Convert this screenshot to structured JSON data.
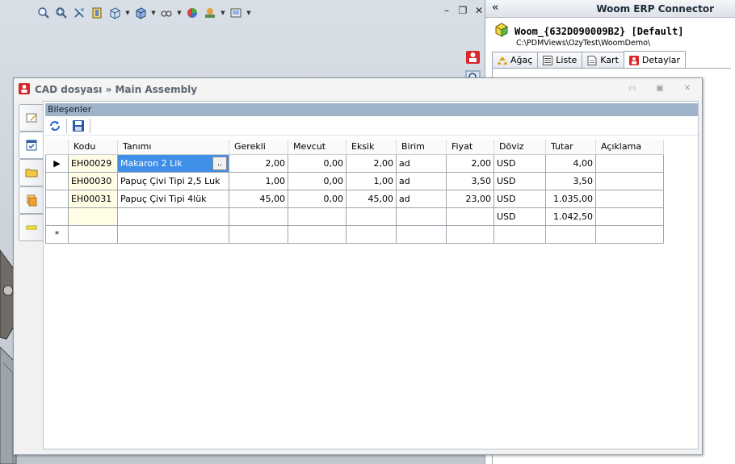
{
  "erp": {
    "title": "Woom ERP Connector",
    "collapse": "«",
    "doc_name": "Woom_{632D090009B2} [Default]",
    "doc_path": "C:\\PDMViews\\OzyTest\\WoomDemo\\",
    "tabs": [
      {
        "label": "Ağaç",
        "icon": "tree-icon",
        "active": false
      },
      {
        "label": "Liste",
        "icon": "list-icon",
        "active": false
      },
      {
        "label": "Kart",
        "icon": "card-icon",
        "active": false
      },
      {
        "label": "Detaylar",
        "icon": "om-logo-icon",
        "active": true
      }
    ]
  },
  "cad_window": {
    "title": "CAD dosyası » Main Assembly",
    "group_title": "Bileşenler",
    "columns": [
      "Kodu",
      "Tanımı",
      "Gerekli",
      "Mevcut",
      "Eksik",
      "Birim",
      "Fiyat",
      "Döviz",
      "Tutar",
      "Açıklama"
    ],
    "rows": [
      {
        "indicator": "▶",
        "kodu": "EH00029",
        "tanimi": "Makaron 2 Lik",
        "gerekli": "2,00",
        "mevcut": "0,00",
        "eksik": "2,00",
        "birim": "ad",
        "fiyat": "2,00",
        "doviz": "USD",
        "tutar": "4,00",
        "aciklama": ""
      },
      {
        "indicator": "",
        "kodu": "EH00030",
        "tanimi": "Papuç Çivi Tipi 2,5 Luk",
        "gerekli": "1,00",
        "mevcut": "0,00",
        "eksik": "1,00",
        "birim": "ad",
        "fiyat": "3,50",
        "doviz": "USD",
        "tutar": "3,50",
        "aciklama": ""
      },
      {
        "indicator": "",
        "kodu": "EH00031",
        "tanimi": "Papuç Çivi Tipi 4lük",
        "gerekli": "45,00",
        "mevcut": "0,00",
        "eksik": "45,00",
        "birim": "ad",
        "fiyat": "23,00",
        "doviz": "USD",
        "tutar": "1.035,00",
        "aciklama": ""
      }
    ],
    "total": {
      "doviz": "USD",
      "tutar": "1.042,50"
    },
    "new_row_indicator": "*",
    "editor_button": ".."
  },
  "colors": {
    "selection": "#3f8fe8",
    "group_header": "#9fb3c8",
    "code_cell": "#fffde6"
  }
}
